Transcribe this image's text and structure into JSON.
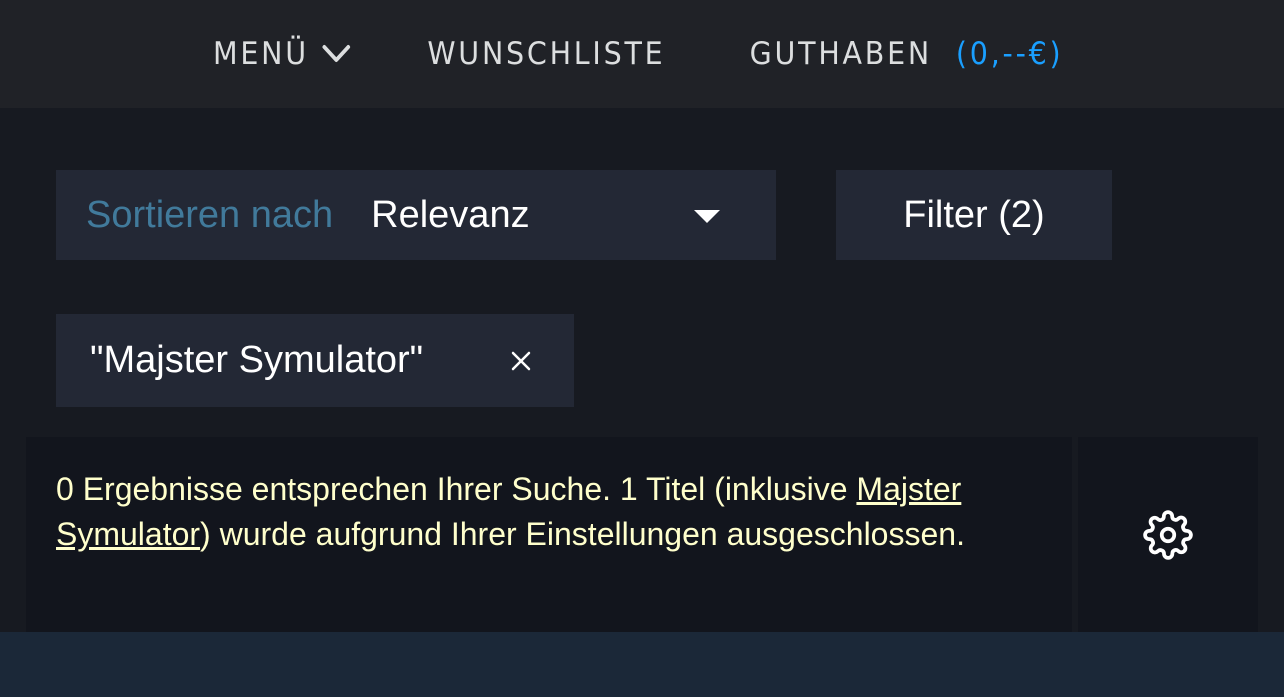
{
  "nav": {
    "menu_label": "MENÜ",
    "wishlist_label": "WUNSCHLISTE",
    "wallet_label": "GUTHABEN",
    "wallet_balance": "(0,--€)"
  },
  "sort": {
    "label": "Sortieren nach",
    "value": "Relevanz"
  },
  "filter": {
    "label": "Filter (2)"
  },
  "search_chip": {
    "text": "\"Majster Symulator\""
  },
  "notice": {
    "text_before": "0 Ergebnisse entsprechen Ihrer Suche. 1 Titel (inklusive ",
    "link_text": "Majster Symulator",
    "text_after": ") wurde aufgrund Ihrer Einstellungen ausgeschlossen."
  },
  "colors": {
    "accent_blue": "#1a9fff",
    "notice_text": "#ffffcc",
    "sort_label": "#417a9b"
  },
  "icons": {
    "menu": "chevron-down-icon",
    "chip_close": "close-icon",
    "settings": "gear-icon",
    "sort": "caret-down-icon"
  }
}
